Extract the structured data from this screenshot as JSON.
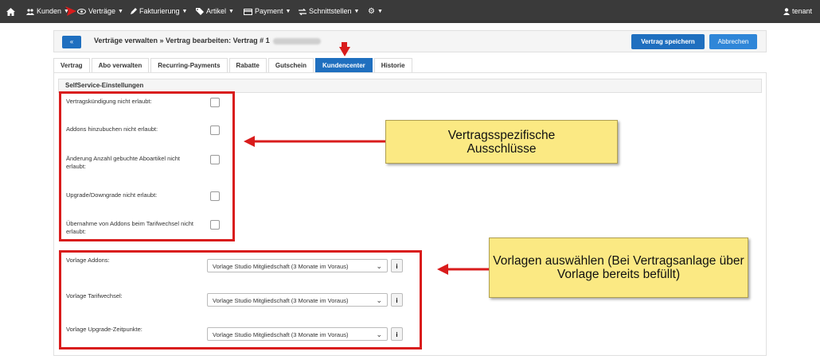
{
  "nav": {
    "items": [
      {
        "label": "Kunden",
        "icon": "users-icon"
      },
      {
        "label": "Verträge",
        "icon": "eye-icon"
      },
      {
        "label": "Fakturierung",
        "icon": "pen-icon"
      },
      {
        "label": "Artikel",
        "icon": "tag-icon"
      },
      {
        "label": "Payment",
        "icon": "card-icon"
      },
      {
        "label": "Schnittstellen",
        "icon": "exchange-icon"
      }
    ],
    "user": "tenant"
  },
  "header": {
    "back_label": "«",
    "title": "Verträge verwalten » Vertrag bearbeiten: Vertrag # 1",
    "save_label": "Vertrag speichern",
    "cancel_label": "Abbrechen"
  },
  "tabs": [
    "Vertrag",
    "Abo verwalten",
    "Recurring-Payments",
    "Rabatte",
    "Gutschein",
    "Kundencenter",
    "Historie"
  ],
  "active_tab": "Kundencenter",
  "section": {
    "title": "SelfService-Einstellungen",
    "checkboxes": [
      "Vertragskündigung nicht erlaubt:",
      "Addons hinzubuchen nicht erlaubt:",
      "Änderung Anzahl gebuchte Aboartikel nicht erlaubt:",
      "Upgrade/Downgrade nicht erlaubt:",
      "Übernahme von Addons beim Tarifwechsel nicht erlaubt:"
    ],
    "selects": [
      {
        "label": "Vorlage Addons:",
        "value": "Vorlage Studio Mitgliedschaft (3 Monate im Voraus)"
      },
      {
        "label": "Vorlage Tarifwechsel:",
        "value": "Vorlage Studio Mitgliedschaft (3 Monate im Voraus)"
      },
      {
        "label": "Vorlage Upgrade-Zeitpunkte:",
        "value": "Vorlage Studio Mitgliedschaft (3 Monate im Voraus)"
      }
    ]
  },
  "callouts": {
    "exclusions": "Vertragsspezifische Ausschlüsse",
    "templates": "Vorlagen auswählen (Bei Vertragsanlage über Vorlage bereits befüllt)"
  },
  "colors": {
    "nav_bg": "#3a3a3a",
    "primary": "#1f6fbf",
    "annotation_red": "#d91c1c",
    "callout_bg": "#fbe983"
  }
}
